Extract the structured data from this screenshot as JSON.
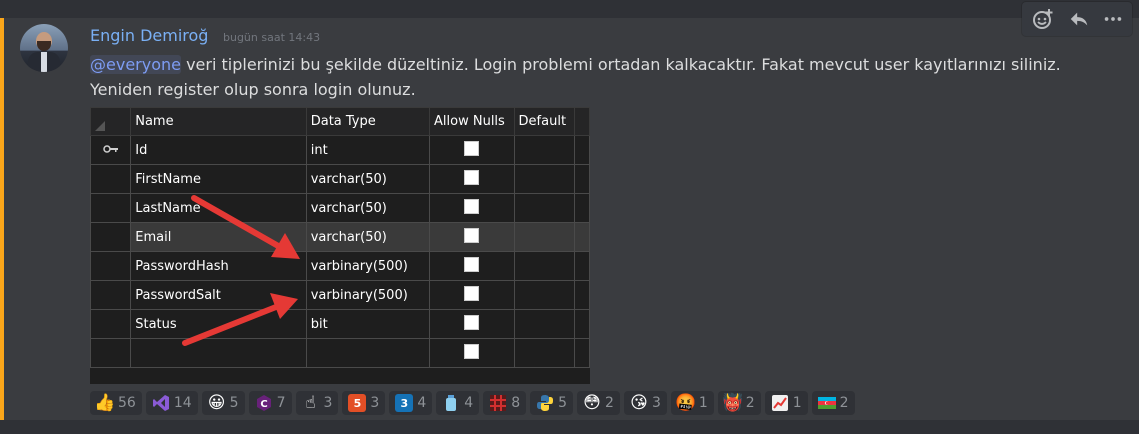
{
  "message": {
    "username": "Engin Demiroğ",
    "timestamp": "bugün saat 14:43",
    "mention": "@everyone",
    "line1": " veri tiplerinizi bu şekilde düzeltiniz. Login problemi ortadan kalkacaktır. Fakat mevcut user kayıtlarınızı siliniz.",
    "line2": "Yeniden register olup sonra login olunuz."
  },
  "colors": {
    "username": "#7ab0f5",
    "mention_bar": "#faa61a",
    "arrow": "#e53935"
  },
  "hover_actions": [
    "add-reaction-icon",
    "reply-icon",
    "more-icon"
  ],
  "table": {
    "headers": [
      "Name",
      "Data Type",
      "Allow Nulls",
      "Default"
    ],
    "rows": [
      {
        "name": "Id",
        "type": "int",
        "key": true
      },
      {
        "name": "FirstName",
        "type": "varchar(50)"
      },
      {
        "name": "LastName",
        "type": "varchar(50)"
      },
      {
        "name": "Email",
        "type": "varchar(50)",
        "selected": true
      },
      {
        "name": "PasswordHash",
        "type": "varbinary(500)"
      },
      {
        "name": "PasswordSalt",
        "type": "varbinary(500)"
      },
      {
        "name": "Status",
        "type": "bit"
      },
      {
        "name": "",
        "type": ""
      }
    ]
  },
  "reactions": [
    {
      "icon": "thumbs-up-icon",
      "count": "56"
    },
    {
      "icon": "visual-studio-icon",
      "count": "14"
    },
    {
      "icon": "grinning-face-icon",
      "count": "5"
    },
    {
      "icon": "csharp-icon",
      "count": "7"
    },
    {
      "icon": "point-up-icon",
      "count": "3"
    },
    {
      "icon": "html5-icon",
      "count": "3"
    },
    {
      "icon": "css3-icon",
      "count": "4"
    },
    {
      "icon": "bottle-icon",
      "count": "4"
    },
    {
      "icon": "red-grid-icon",
      "count": "8"
    },
    {
      "icon": "python-icon",
      "count": "5"
    },
    {
      "icon": "flushed-face-icon",
      "count": "2"
    },
    {
      "icon": "kissing-face-icon",
      "count": "3"
    },
    {
      "icon": "cursing-face-icon",
      "count": "1"
    },
    {
      "icon": "ogre-icon",
      "count": "2"
    },
    {
      "icon": "chart-increasing-icon",
      "count": "1"
    },
    {
      "icon": "azerbaijan-flag-icon",
      "count": "2"
    }
  ]
}
